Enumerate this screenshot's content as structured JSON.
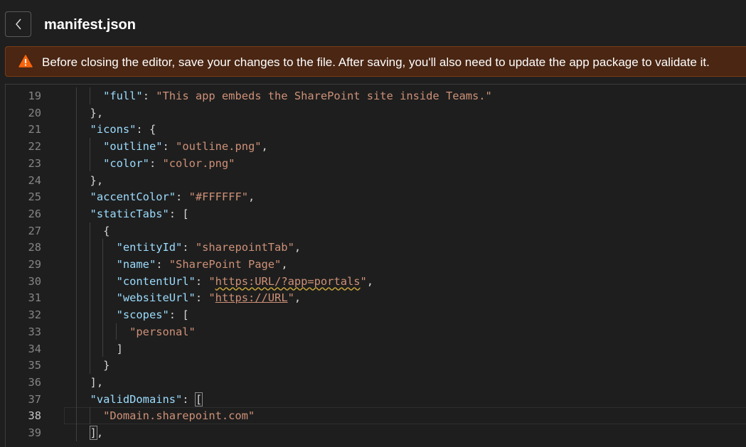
{
  "header": {
    "back_label": "",
    "title": "manifest.json"
  },
  "warning": {
    "text": "Before closing the editor, save your changes to the file. After saving, you'll also need to update the app package to validate it."
  },
  "editor": {
    "current_line": 38,
    "lines": [
      {
        "num": "19",
        "text": "    \"full\": \"This app embeds the SharePoint site inside Teams.\""
      },
      {
        "num": "20",
        "text": "  },"
      },
      {
        "num": "21",
        "text": "  \"icons\": {"
      },
      {
        "num": "22",
        "text": "    \"outline\": \"outline.png\","
      },
      {
        "num": "23",
        "text": "    \"color\": \"color.png\""
      },
      {
        "num": "24",
        "text": "  },"
      },
      {
        "num": "25",
        "text": "  \"accentColor\": \"#FFFFFF\","
      },
      {
        "num": "26",
        "text": "  \"staticTabs\": ["
      },
      {
        "num": "27",
        "text": "    {"
      },
      {
        "num": "28",
        "text": "      \"entityId\": \"sharepointTab\","
      },
      {
        "num": "29",
        "text": "      \"name\": \"SharePoint Page\","
      },
      {
        "num": "30",
        "text": "      \"contentUrl\": \"https:URL/?app=portals\","
      },
      {
        "num": "31",
        "text": "      \"websiteUrl\": \"https://URL\","
      },
      {
        "num": "32",
        "text": "      \"scopes\": ["
      },
      {
        "num": "33",
        "text": "        \"personal\""
      },
      {
        "num": "34",
        "text": "      ]"
      },
      {
        "num": "35",
        "text": "    }"
      },
      {
        "num": "36",
        "text": "  ],"
      },
      {
        "num": "37",
        "text": "  \"validDomains\": ["
      },
      {
        "num": "38",
        "text": "    \"Domain.sharepoint.com\""
      },
      {
        "num": "39",
        "text": "  ],"
      }
    ]
  },
  "colors": {
    "key": "#9cdcfe",
    "string": "#ce9178",
    "punctuation": "#d4d4d4",
    "warning_bg": "#4a2613",
    "warning_icon": "#f7630c"
  }
}
